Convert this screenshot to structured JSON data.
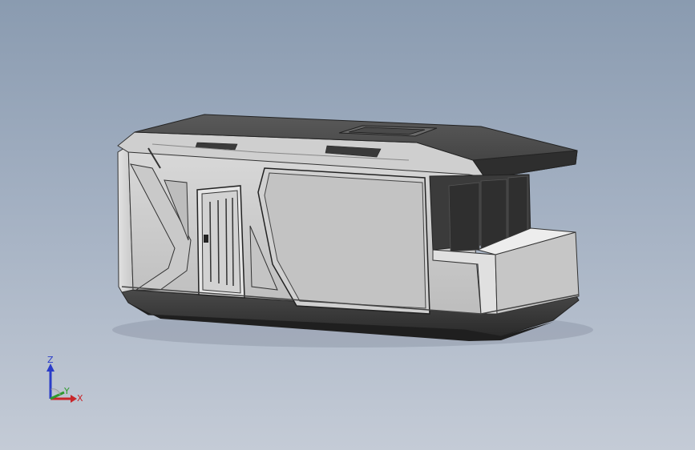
{
  "viewport": {
    "background_top": "#8a9bb0",
    "background_bottom": "#c4cbd6",
    "model": "container-house"
  },
  "triad": {
    "z_label": "Z",
    "y_label": "Y",
    "x_label": "X",
    "z_color": "#2a3cc8",
    "y_color": "#2e9a2e",
    "x_color": "#c8262a"
  }
}
